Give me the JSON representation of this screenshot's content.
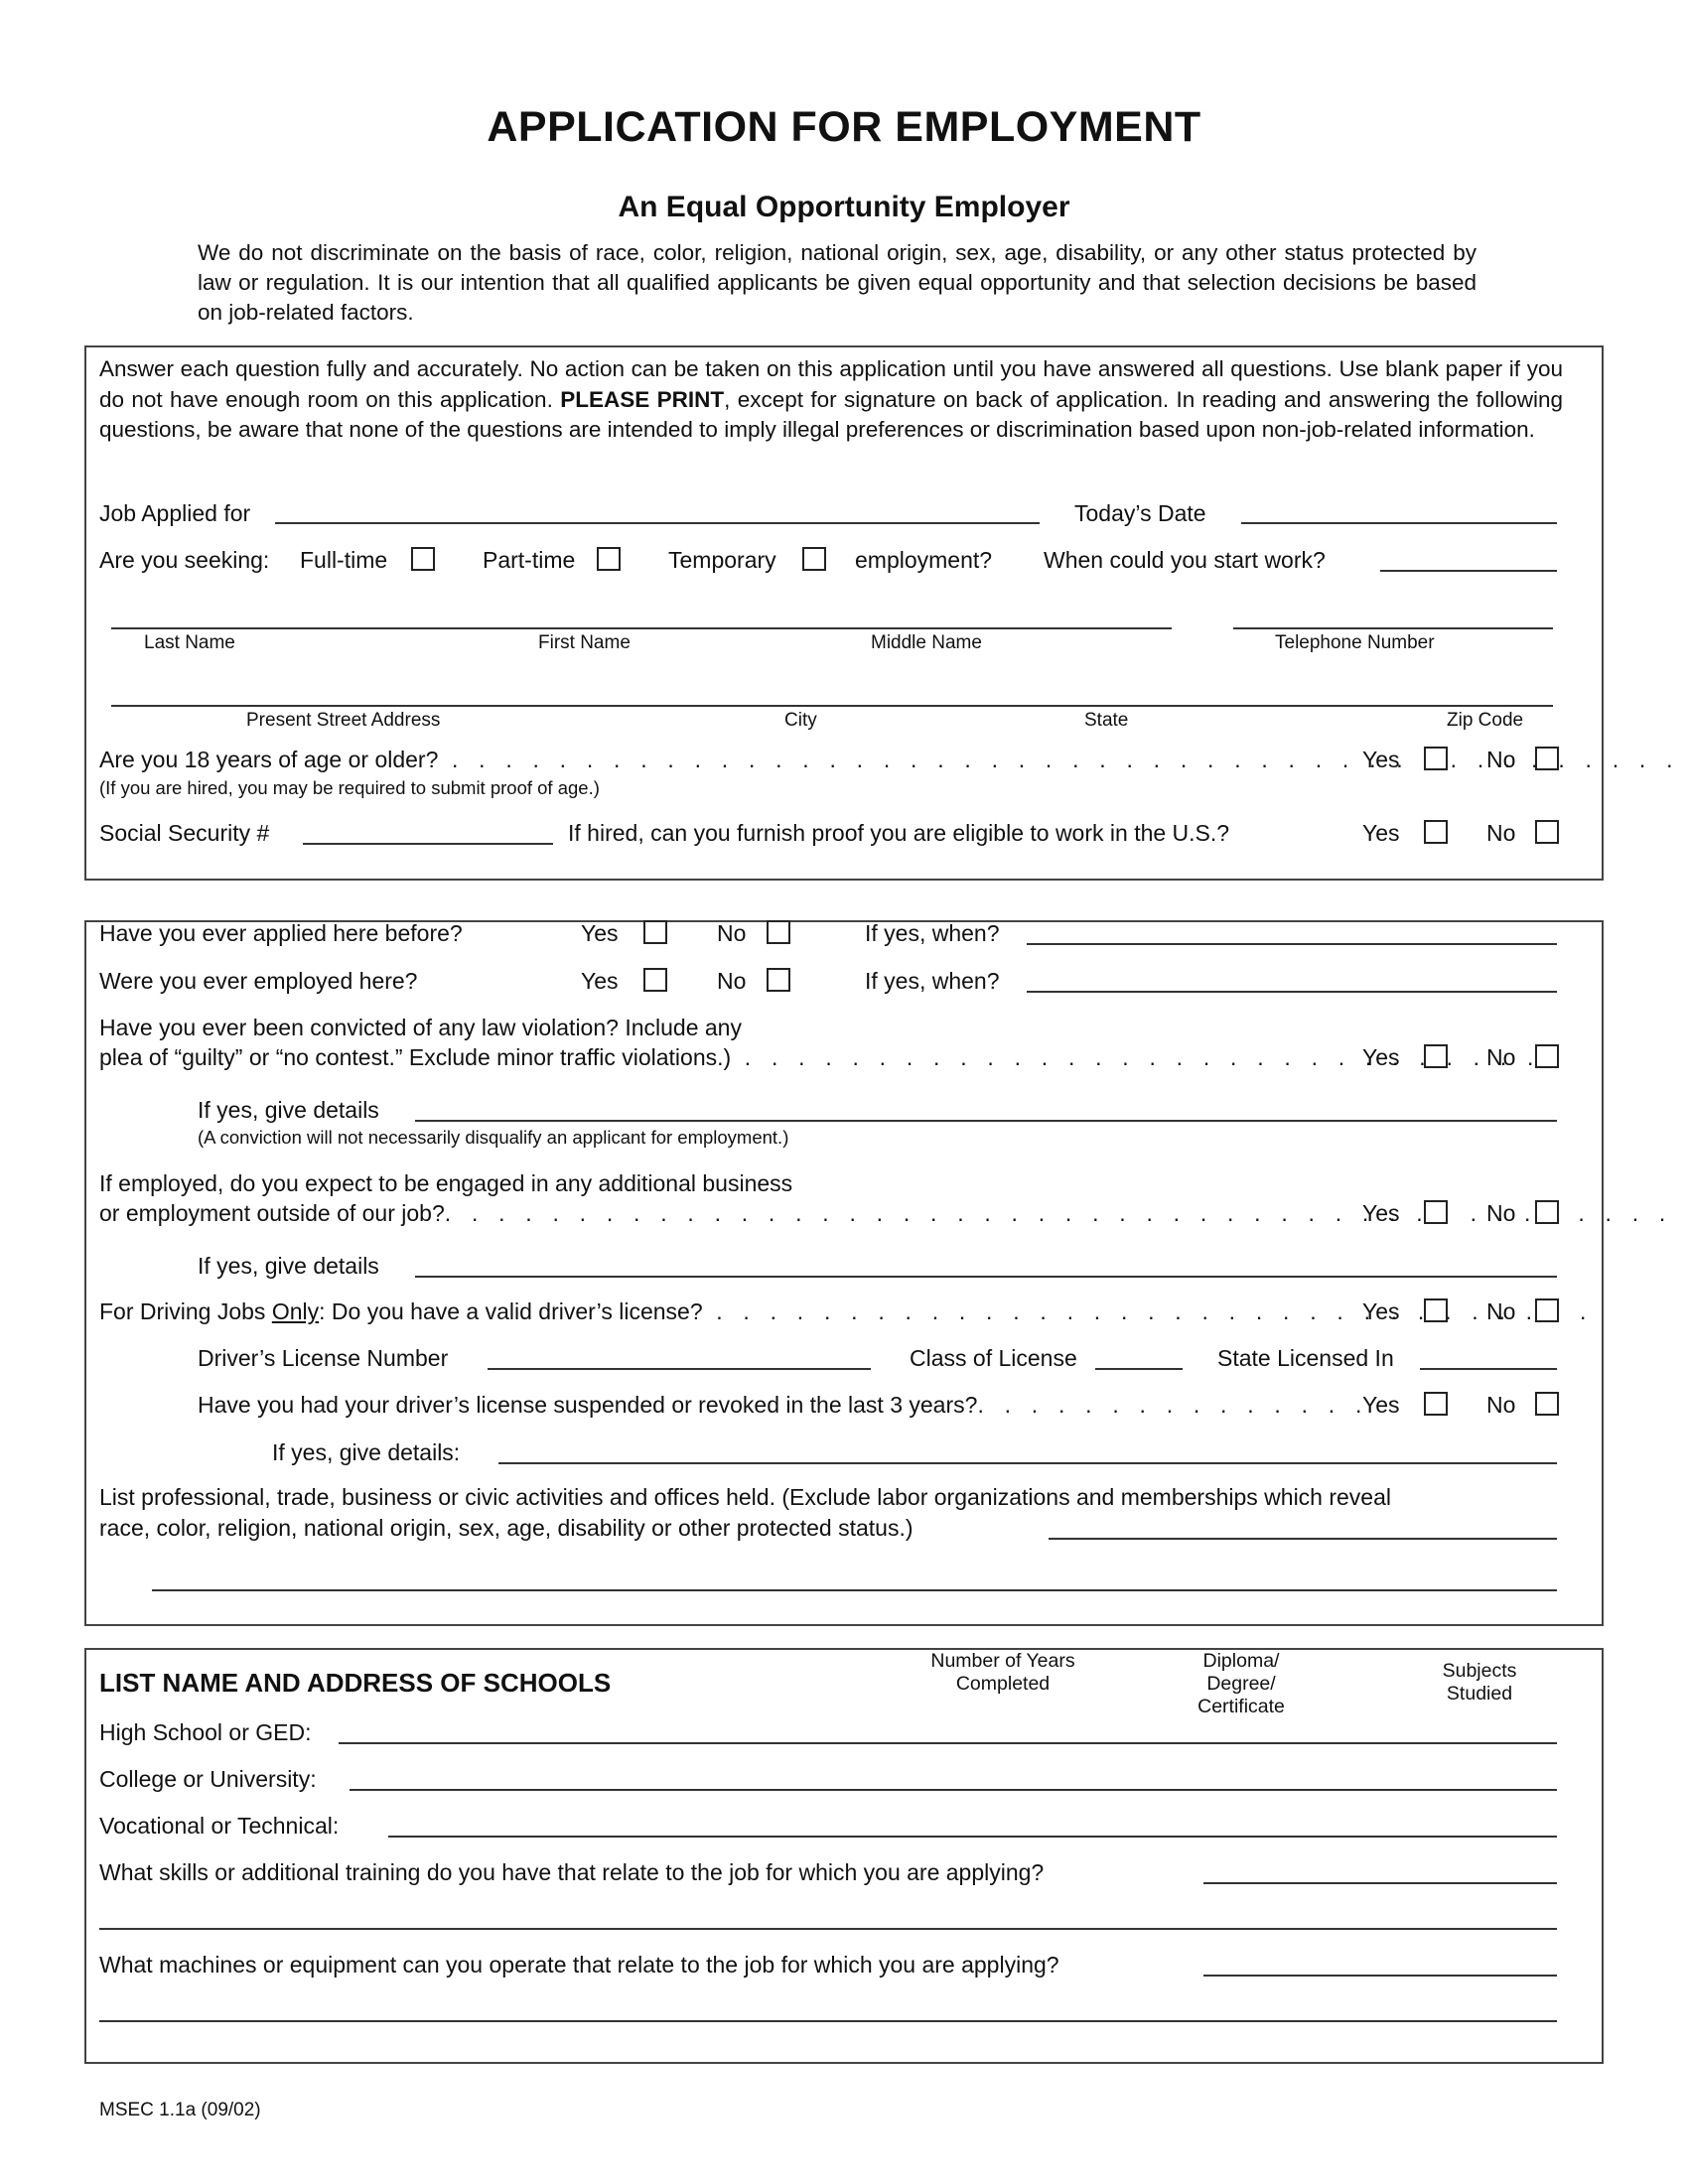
{
  "header": {
    "title": "APPLICATION FOR EMPLOYMENT",
    "subtitle": "An Equal Opportunity Employer",
    "statement": "We do not discriminate on the basis of race, color, religion, national origin, sex, age, disability, or any other status protected by law or regulation. It is our intention that all qualified applicants be given equal opportunity and that selection decisions be based on job-related factors."
  },
  "section1": {
    "instructions_pre": "Answer each question fully and accurately. No action can be taken on this application until you have answered all questions. Use blank paper if you do not have enough room on this application. ",
    "instructions_bold": "PLEASE PRINT",
    "instructions_post": ", except for signature on back of application. In reading and answering the following questions, be aware that none of the questions are intended to imply illegal preferences or discrimination based upon non-job-related information.",
    "job_applied_label": "Job Applied for",
    "job_applied_value": "",
    "todays_date_label": "Today’s Date",
    "todays_date_value": "",
    "seeking_label": "Are you seeking:",
    "full_time_label": "Full-time",
    "part_time_label": "Part-time",
    "temporary_label": "Temporary",
    "employment_suffix": "employment?",
    "start_work_label": "When could you start work?",
    "start_work_value": "",
    "name_labels": [
      "Last Name",
      "First Name",
      "Middle Name"
    ],
    "telephone_label": "Telephone Number",
    "address_labels": [
      "Present Street Address",
      "City",
      "State",
      "Zip Code"
    ],
    "age_question": "Are you 18 years of age or older?",
    "age_note": "(If you are hired, you may be required to submit proof of age.)",
    "ssn_label": "Social Security #",
    "ssn_value": "",
    "eligible_question": "If hired, can you furnish proof you are eligible to work in the U.S.?",
    "yes_label": "Yes",
    "no_label": "No"
  },
  "section2": {
    "applied_before": "Have you ever applied here before?",
    "employed_before": "Were you ever employed here?",
    "if_yes_when": "If yes, when?",
    "convicted_line1": "Have you ever been convicted of any law violation? Include any",
    "convicted_line2": "plea of “guilty” or “no contest.” Exclude minor traffic violations.)",
    "if_yes_details": "If yes, give details",
    "conviction_note": "(A conviction will not necessarily disqualify an applicant for employment.)",
    "outside_line1": "If employed, do you expect to be engaged in any additional business",
    "outside_line2": "or employment outside of our job?",
    "driving_prefix": "For Driving Jobs ",
    "driving_only": "Only",
    "driving_question": ": Do you have a valid driver’s license?",
    "license_number_label": "Driver’s License Number",
    "license_class_label": "Class of License",
    "state_licensed_label": "State Licensed In",
    "suspended_question": "Have you had your driver’s license suspended or revoked in the last 3 years?",
    "if_yes_details_colon": "If yes, give details:",
    "activities_line1": "List professional, trade, business or civic activities and offices held. (Exclude labor organizations and memberships which reveal",
    "activities_line2": "race, color, religion, national origin, sex, age, disability or other protected status.)",
    "yes_label": "Yes",
    "no_label": "No"
  },
  "section3": {
    "heading": "LIST NAME AND ADDRESS OF SCHOOLS",
    "col_years": "Number of Years Completed",
    "col_diploma": "Diploma/ Degree/ Certificate",
    "col_subjects": "Subjects Studied",
    "high_school_label": "High School or GED:",
    "college_label": "College or University:",
    "vocational_label": "Vocational or Technical:",
    "skills_question": "What skills or additional training do you have that relate to the job for which you are applying?",
    "machines_question": "What machines or equipment can you operate that relate to the job for which you are applying?"
  },
  "footer": {
    "form_code": "MSEC 1.1a (09/02)"
  }
}
